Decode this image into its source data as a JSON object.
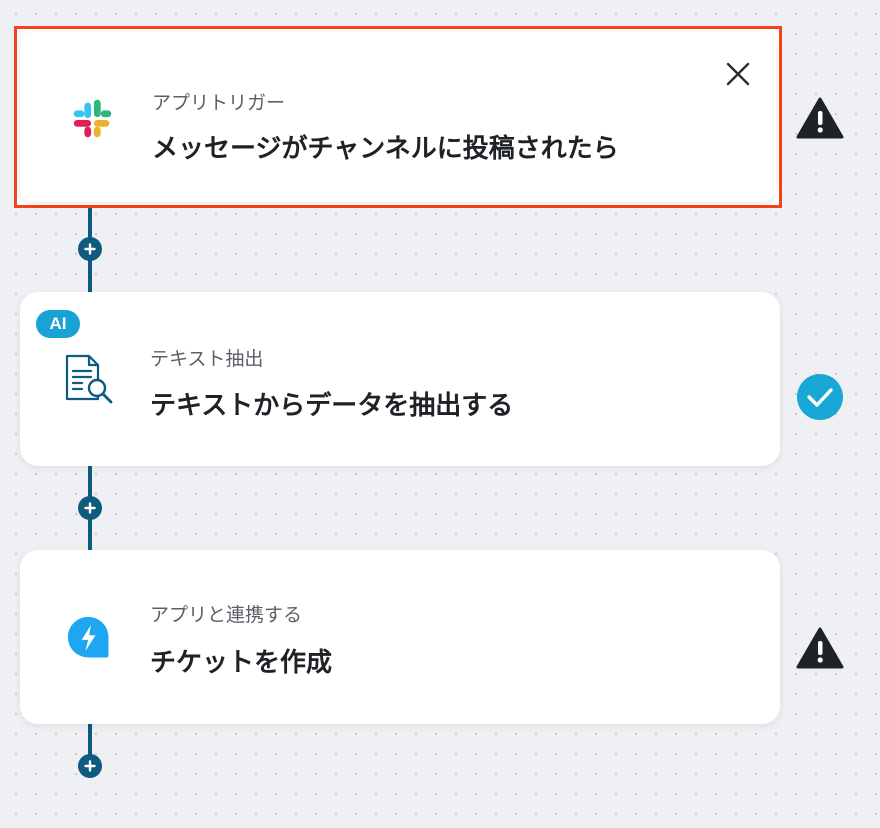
{
  "steps": [
    {
      "category": "アプリトリガー",
      "title": "メッセージがチャンネルに投稿されたら",
      "app_icon": "slack-icon",
      "status": "warning"
    },
    {
      "badge": "AI",
      "category": "テキスト抽出",
      "title": "テキストからデータを抽出する",
      "app_icon": "document-search-icon",
      "status": "complete"
    },
    {
      "category": "アプリと連携する",
      "title": "チケットを作成",
      "app_icon": "freshdesk-icon",
      "status": "warning"
    }
  ],
  "colors": {
    "connector": "#0e5b7f",
    "selected_border": "#f2431b",
    "success": "#19a8d6",
    "warning": "#1f2328",
    "ai_badge": "#18a3d4"
  }
}
